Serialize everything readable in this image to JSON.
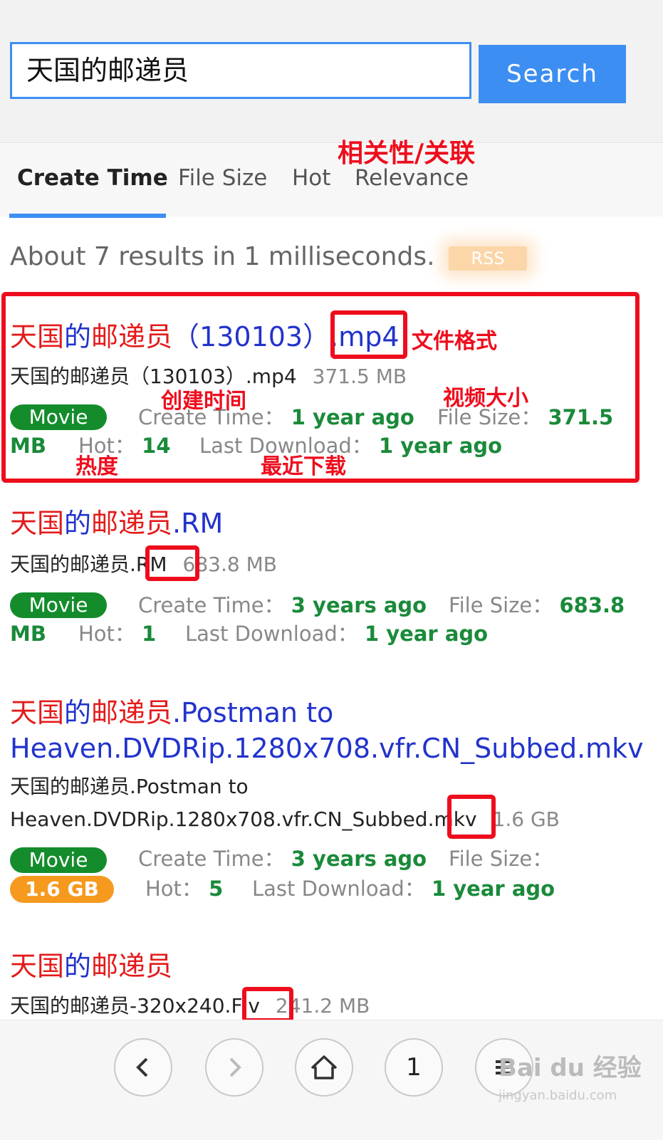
{
  "search": {
    "value": "天国的邮递员",
    "button": "Search"
  },
  "tabs": [
    "Create Time",
    "File Size",
    "Hot",
    "Relevance"
  ],
  "summary": "About 7 results in 1 milliseconds.",
  "rss": "RSS",
  "labels": {
    "create": "Create Time：",
    "size": "File Size：",
    "hot": "Hot：",
    "last": "Last Download："
  },
  "results": [
    {
      "title_red": "天国",
      "title_blue1": "的",
      "title_red2": "邮递员",
      "title_blue2": "（130103）.mp4",
      "file": "天国的邮递员（130103）.mp4",
      "size": "371.5 MB",
      "badge": "Movie",
      "create": "1 year ago",
      "filesize": "371.5 MB",
      "hot": "14",
      "last": "1 year ago"
    },
    {
      "title_red": "天国",
      "title_blue1": "的",
      "title_red2": "邮递员",
      "title_blue2": ".RM",
      "file": "天国的邮递员.RM",
      "size": "683.8 MB",
      "badge": "Movie",
      "create": "3 years ago",
      "filesize": "683.8 MB",
      "hot": "1",
      "last": "1 year ago"
    },
    {
      "title_red": "天国",
      "title_blue1": "的",
      "title_red2": "邮递员",
      "title_blue2": ".Postman to",
      "title_line2": "Heaven.DVDRip.1280x708.vfr.CN_Subbed.mkv",
      "file": "天国的邮递员.Postman to",
      "file_line2": "Heaven.DVDRip.1280x708.vfr.CN_Subbed.mkv",
      "size": "1.6 GB",
      "badge": "Movie",
      "create": "3 years ago",
      "filesize": "1.6 GB",
      "hot": "5",
      "last": "1 year ago"
    },
    {
      "title_red": "天国",
      "title_blue1": "的",
      "title_red2": "邮递员",
      "file": "天国的邮递员-320x240.Flv",
      "size": "241.2 MB"
    }
  ],
  "annotations": {
    "relevance": "相关性/关联",
    "format": "文件格式",
    "create": "创建时间",
    "size": "视频大小",
    "hot": "热度",
    "last": "最近下载"
  },
  "nav": {
    "tabs_count": "1"
  },
  "watermark": {
    "main": "Bai du 经验",
    "sub": "jingyan.baidu.com"
  }
}
